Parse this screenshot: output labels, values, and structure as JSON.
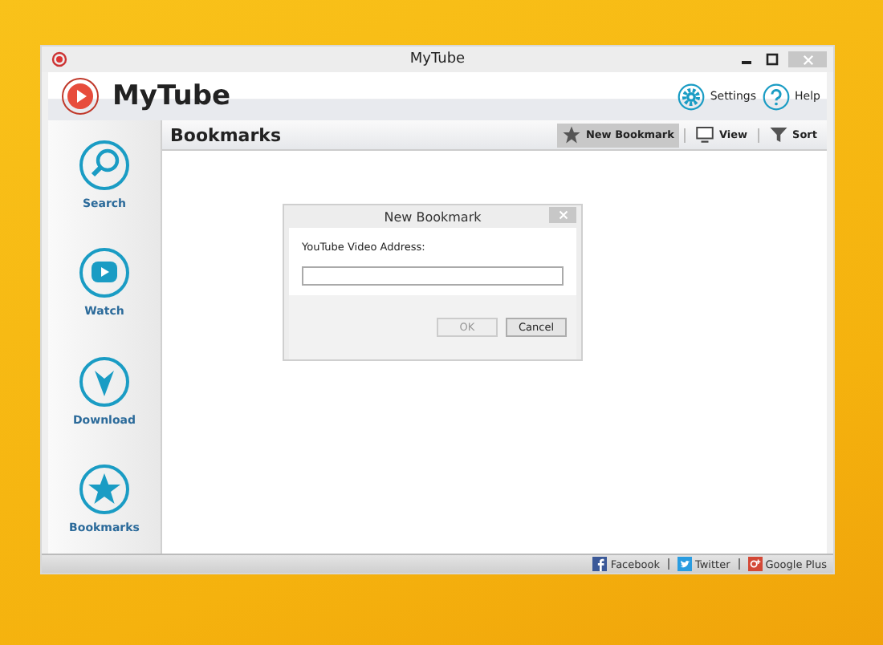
{
  "window": {
    "title": "MyTube"
  },
  "header": {
    "app_name": "MyTube",
    "actions": [
      {
        "kind": "settings",
        "label": "Settings"
      },
      {
        "kind": "help",
        "label": "Help"
      }
    ]
  },
  "sidebar": {
    "items": [
      {
        "kind": "search",
        "label": "Search"
      },
      {
        "kind": "watch",
        "label": "Watch"
      },
      {
        "kind": "download",
        "label": "Download"
      },
      {
        "kind": "bookmarks",
        "label": "Bookmarks"
      }
    ]
  },
  "content": {
    "title": "Bookmarks",
    "toolbar": [
      {
        "kind": "new",
        "label": "New Bookmark",
        "selected": true
      },
      {
        "kind": "view",
        "label": "View",
        "selected": false
      },
      {
        "kind": "sort",
        "label": "Sort",
        "selected": false
      }
    ]
  },
  "dialog": {
    "title": "New Bookmark",
    "field_label": "YouTube Video Address:",
    "buttons": [
      {
        "label": "OK",
        "disabled": true
      },
      {
        "label": "Cancel",
        "disabled": false
      }
    ]
  },
  "status_bar": {
    "links": [
      {
        "kind": "facebook",
        "label": "Facebook"
      },
      {
        "kind": "twitter",
        "label": "Twitter"
      },
      {
        "kind": "googleplus",
        "label": "Google Plus"
      }
    ]
  }
}
